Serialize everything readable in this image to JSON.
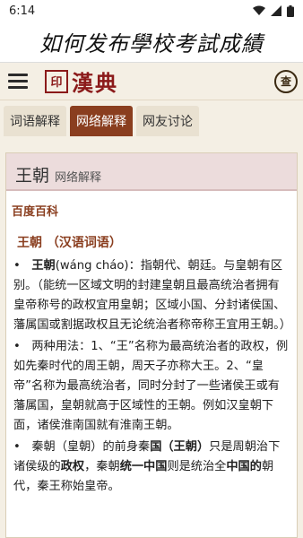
{
  "status": {
    "time": "6:14"
  },
  "banner": {
    "text": "如何发布學校考試成績"
  },
  "appbar": {
    "logo_seal": "漢典",
    "logo_text": "漢典",
    "search_label": "查"
  },
  "tabs": [
    {
      "label": "词语解释"
    },
    {
      "label": "网络解释"
    },
    {
      "label": "网友讨论"
    }
  ],
  "card": {
    "word": "王朝",
    "subtitle": "网络解释",
    "source": "百度百科",
    "entry_title": "王朝 （汉语词语）",
    "para1_bold": "王朝",
    "para1_rest": "(wáng cháo)：指朝代、朝廷。与皇朝有区别。（能统一区域文明的封建皇朝且最高统治者拥有皇帝称号的政权宜用皇朝；区域小国、分封诸侯国、藩属国或割据政权且无论统治者称帝称王宜用王朝。）",
    "para2": "两种用法：1、“王”名称为最高统治者的政权，例如先秦时代的周王朝，周天子亦称大王。2、“皇帝”名称为最高统治者，同时分封了一些诸侯王或有藩属国，皇朝就高于区域性的王朝。例如汉皇朝下面，诸侯淮南国就有淮南王朝。",
    "para3_a": "秦朝（皇朝）的前身秦",
    "para3_b": "国（王朝）",
    "para3_c": "只是周朝治下诸侯级的",
    "para3_d": "政权",
    "para3_e": "，秦朝",
    "para3_f": "统一中国",
    "para3_g": "则是统治全",
    "para3_h": "中国的",
    "para3_i": "朝代，秦王称始皇帝。"
  }
}
